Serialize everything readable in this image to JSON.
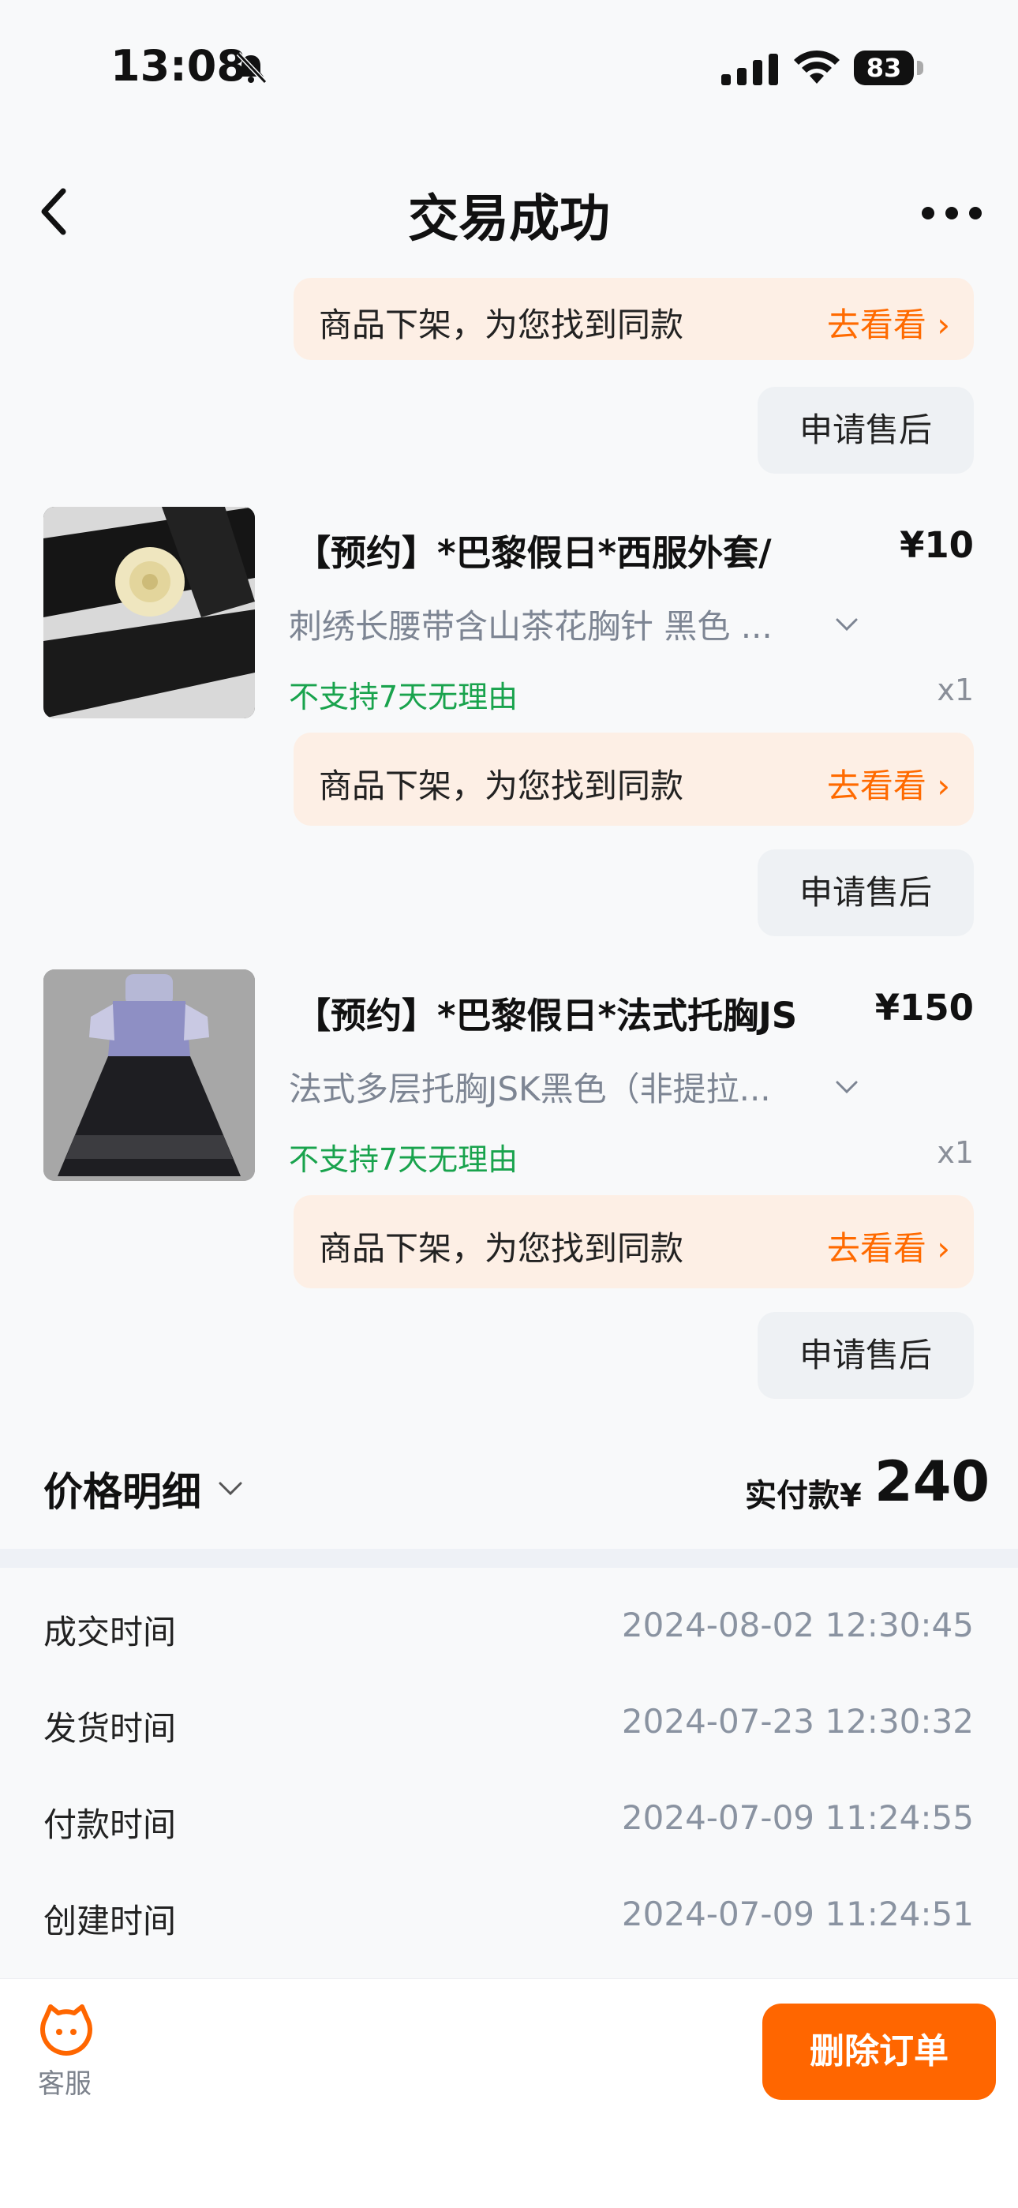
{
  "status_bar": {
    "time": "13:08",
    "battery": "83"
  },
  "nav": {
    "title": "交易成功"
  },
  "top_notice": {
    "text": "商品下架，为您找到同款",
    "link": "去看看"
  },
  "top_after_sale": "申请售后",
  "items": [
    {
      "title": "【预约】*巴黎假日*西服外套/",
      "price": "¥10",
      "spec": "刺绣长腰带含山茶花胸针 黑色 ...",
      "policy": "不支持7天无理由",
      "qty": "x1",
      "notice_text": "商品下架，为您找到同款",
      "notice_link": "去看看",
      "after_sale": "申请售后"
    },
    {
      "title": "【预约】*巴黎假日*法式托胸JS",
      "price": "¥150",
      "spec": "法式多层托胸JSK黑色（非提拉...",
      "policy": "不支持7天无理由",
      "qty": "x1",
      "notice_text": "商品下架，为您找到同款",
      "notice_link": "去看看",
      "after_sale": "申请售后"
    }
  ],
  "price_detail": {
    "label": "价格明细",
    "paid_label": "实付款¥",
    "paid_amount": "240"
  },
  "times": [
    {
      "label": "成交时间",
      "value": "2024-08-02 12:30:45"
    },
    {
      "label": "发货时间",
      "value": "2024-07-23 12:30:32"
    },
    {
      "label": "付款时间",
      "value": "2024-07-09 11:24:55"
    },
    {
      "label": "创建时间",
      "value": "2024-07-09 11:24:51"
    }
  ],
  "bottom": {
    "service_label": "客服",
    "delete_label": "删除订单"
  },
  "colors": {
    "accent": "#ff6600",
    "green": "#19a34d",
    "notice_bg": "#fdefe5"
  }
}
